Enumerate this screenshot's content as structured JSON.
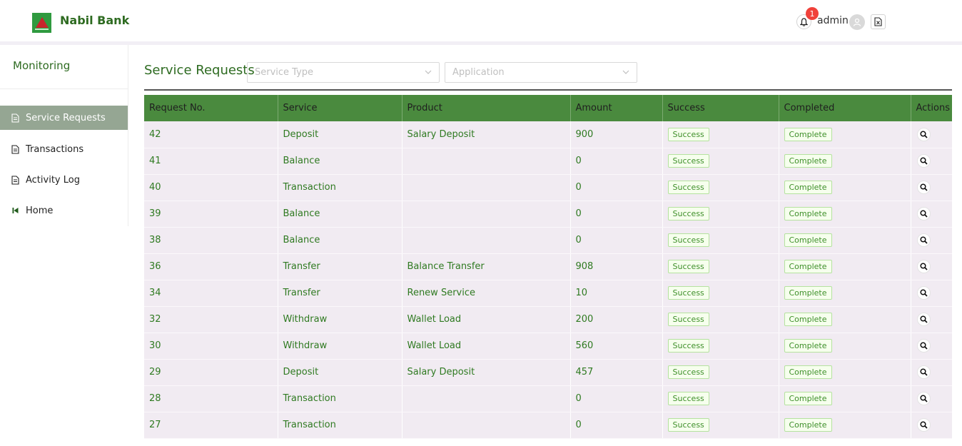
{
  "app": {
    "brand": "Nabil Bank"
  },
  "header": {
    "notification_count": "1",
    "user": "admin"
  },
  "sidebar": {
    "title": "Monitoring",
    "items": [
      {
        "label": "Service Requests",
        "icon": "file-icon",
        "active": true
      },
      {
        "label": "Transactions",
        "icon": "file-icon"
      },
      {
        "label": "Activity Log",
        "icon": "file-icon"
      },
      {
        "label": "Home",
        "icon": "back-icon"
      }
    ]
  },
  "main": {
    "title": "Service Requests",
    "filters": {
      "service_type_placeholder": "Service Type",
      "application_placeholder": "Application"
    },
    "table": {
      "columns": [
        "Request No.",
        "Service",
        "Product",
        "Amount",
        "Success",
        "Completed",
        "Actions"
      ],
      "rows": [
        {
          "id": "42",
          "service": "Deposit",
          "product": "Salary Deposit",
          "amount": "900",
          "success": "Success",
          "completed": "Complete"
        },
        {
          "id": "41",
          "service": "Balance",
          "product": "",
          "amount": "0",
          "success": "Success",
          "completed": "Complete"
        },
        {
          "id": "40",
          "service": "Transaction",
          "product": "",
          "amount": "0",
          "success": "Success",
          "completed": "Complete"
        },
        {
          "id": "39",
          "service": "Balance",
          "product": "",
          "amount": "0",
          "success": "Success",
          "completed": "Complete"
        },
        {
          "id": "38",
          "service": "Balance",
          "product": "",
          "amount": "0",
          "success": "Success",
          "completed": "Complete"
        },
        {
          "id": "36",
          "service": "Transfer",
          "product": "Balance Transfer",
          "amount": "908",
          "success": "Success",
          "completed": "Complete"
        },
        {
          "id": "34",
          "service": "Transfer",
          "product": "Renew Service",
          "amount": "10",
          "success": "Success",
          "completed": "Complete"
        },
        {
          "id": "32",
          "service": "Withdraw",
          "product": "Wallet Load",
          "amount": "200",
          "success": "Success",
          "completed": "Complete"
        },
        {
          "id": "30",
          "service": "Withdraw",
          "product": "Wallet Load",
          "amount": "560",
          "success": "Success",
          "completed": "Complete"
        },
        {
          "id": "29",
          "service": "Deposit",
          "product": "Salary Deposit",
          "amount": "457",
          "success": "Success",
          "completed": "Complete"
        },
        {
          "id": "28",
          "service": "Transaction",
          "product": "",
          "amount": "0",
          "success": "Success",
          "completed": "Complete"
        },
        {
          "id": "27",
          "service": "Transaction",
          "product": "",
          "amount": "0",
          "success": "Success",
          "completed": "Complete"
        }
      ]
    }
  },
  "colors": {
    "brand_green": "#2e6b21",
    "header_green": "#4a8a3e",
    "row_bg": "#f1ebf2",
    "active_sidebar": "#95a693",
    "badge_red": "#f0413a"
  }
}
